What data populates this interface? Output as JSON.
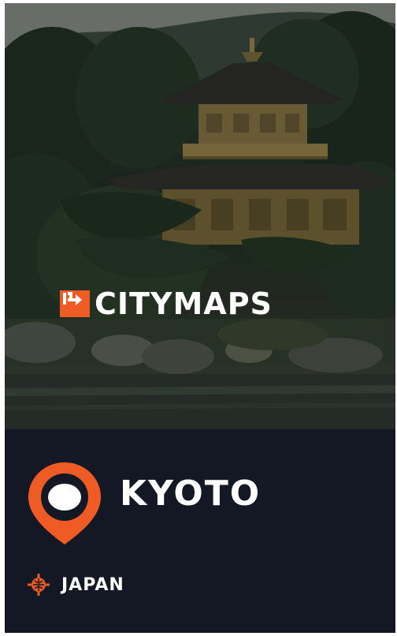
{
  "brand": {
    "name_part1": "CITY",
    "name_part2": "MAPS",
    "logo_color": "#ef5b25"
  },
  "guide": {
    "city": "KYOTO",
    "country": "JAPAN"
  },
  "colors": {
    "panel_background": "#141825",
    "accent": "#ef5b25",
    "text": "#ffffff"
  },
  "icons": {
    "brand_logo": "arrow-sign-icon",
    "city_marker": "map-pin-icon",
    "country_marker": "globe-crosshair-icon"
  }
}
